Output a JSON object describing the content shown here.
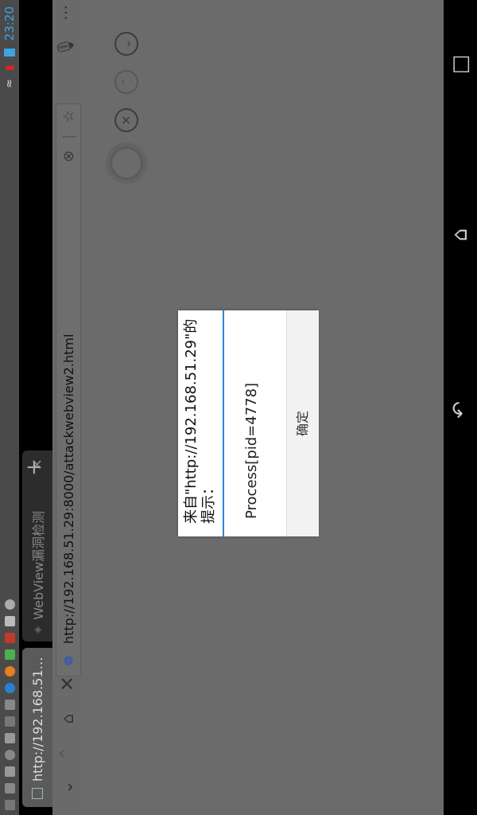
{
  "status_bar": {
    "time": "23:20",
    "notification_icons": [
      "notification-icon-1",
      "notification-icon-2",
      "notification-icon-3",
      "notification-icon-4",
      "notification-icon-5",
      "notification-icon-6",
      "notification-icon-7",
      "notification-icon-8",
      "notification-icon-9",
      "notification-icon-10",
      "notification-icon-11",
      "notification-icon-12"
    ],
    "accent_color": "#3da4e6"
  },
  "tabs": [
    {
      "label": "http://192.168.51....",
      "active": true
    },
    {
      "label": "WebView漏洞检测",
      "active": false
    }
  ],
  "toolbar": {
    "url": "http://192.168.51.29:8000/attackwebview2.html"
  },
  "dialog": {
    "title": "来自\"http://192.168.51.29\"的提示：",
    "message": "Process[pid=4778]",
    "ok_label": "确定"
  }
}
